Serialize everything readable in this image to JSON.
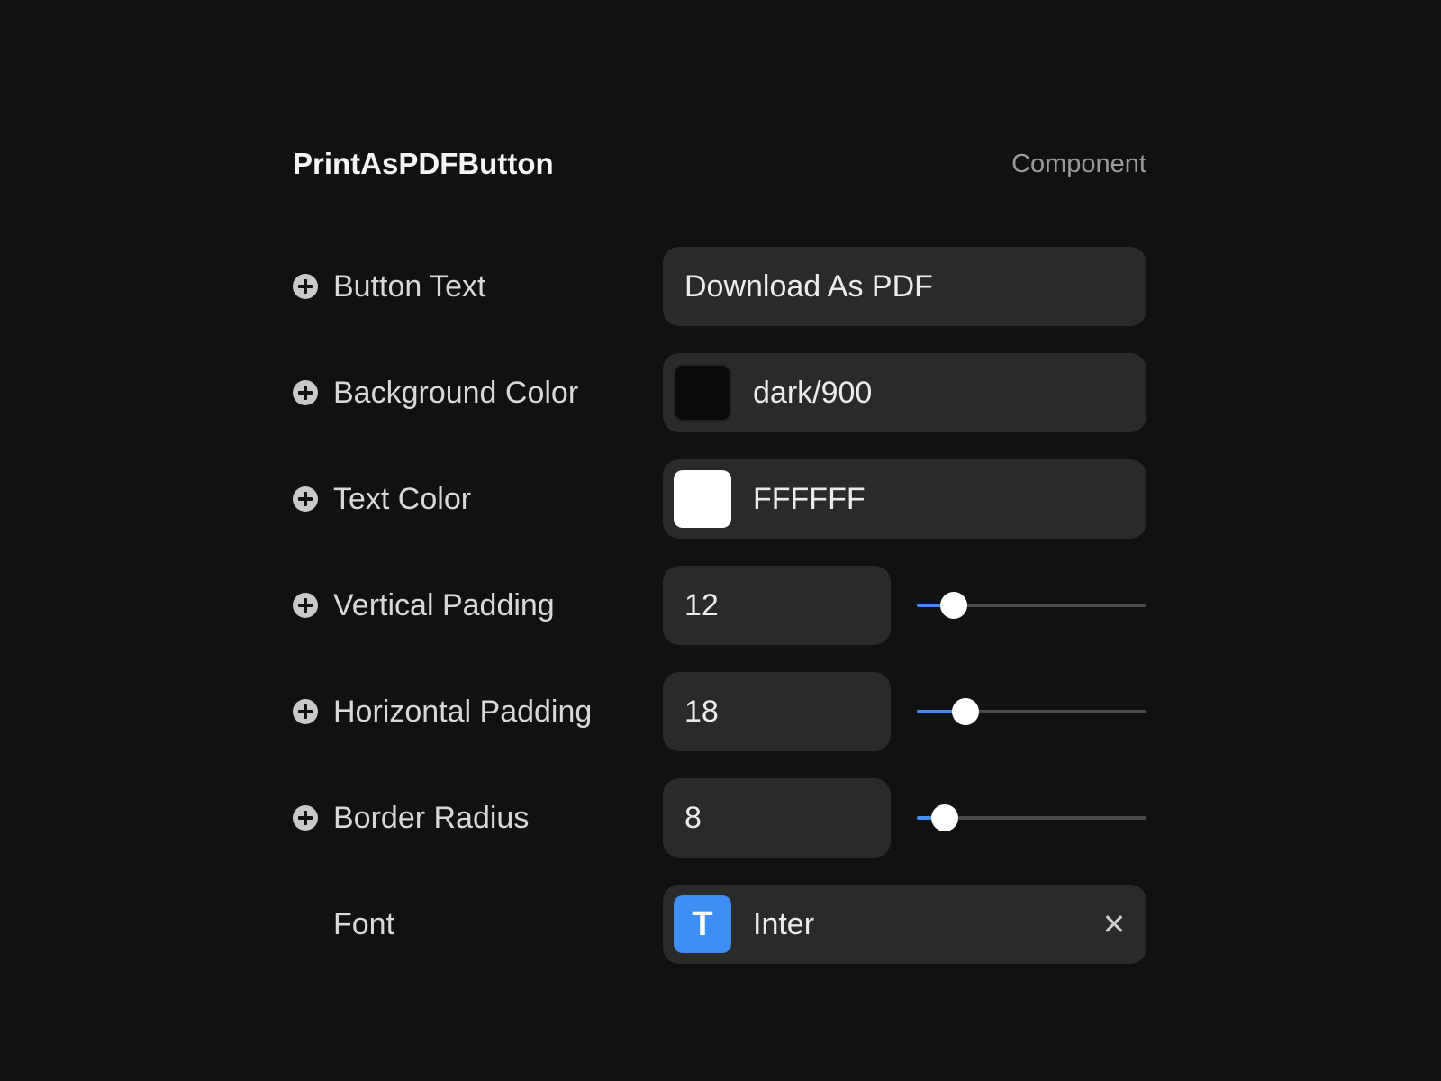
{
  "colors": {
    "accent": "#3d8ef5",
    "background": "#111111",
    "field": "#2a2a2a"
  },
  "header": {
    "title": "PrintAsPDFButton",
    "kind": "Component"
  },
  "properties": {
    "button_text": {
      "label": "Button Text",
      "value": "Download As PDF"
    },
    "background_color": {
      "label": "Background Color",
      "value": "dark/900",
      "swatch": "#0b0b0b"
    },
    "text_color": {
      "label": "Text Color",
      "value": "FFFFFF",
      "swatch": "#ffffff"
    },
    "vertical_padding": {
      "label": "Vertical Padding",
      "value": "12",
      "slider_fraction": 0.16
    },
    "horizontal_padding": {
      "label": "Horizontal Padding",
      "value": "18",
      "slider_fraction": 0.21
    },
    "border_radius": {
      "label": "Border Radius",
      "value": "8",
      "slider_fraction": 0.12
    },
    "font": {
      "label": "Font",
      "value": "Inter",
      "badge_glyph": "T",
      "icon": "font-type-icon",
      "clear_icon": "close-icon"
    }
  }
}
